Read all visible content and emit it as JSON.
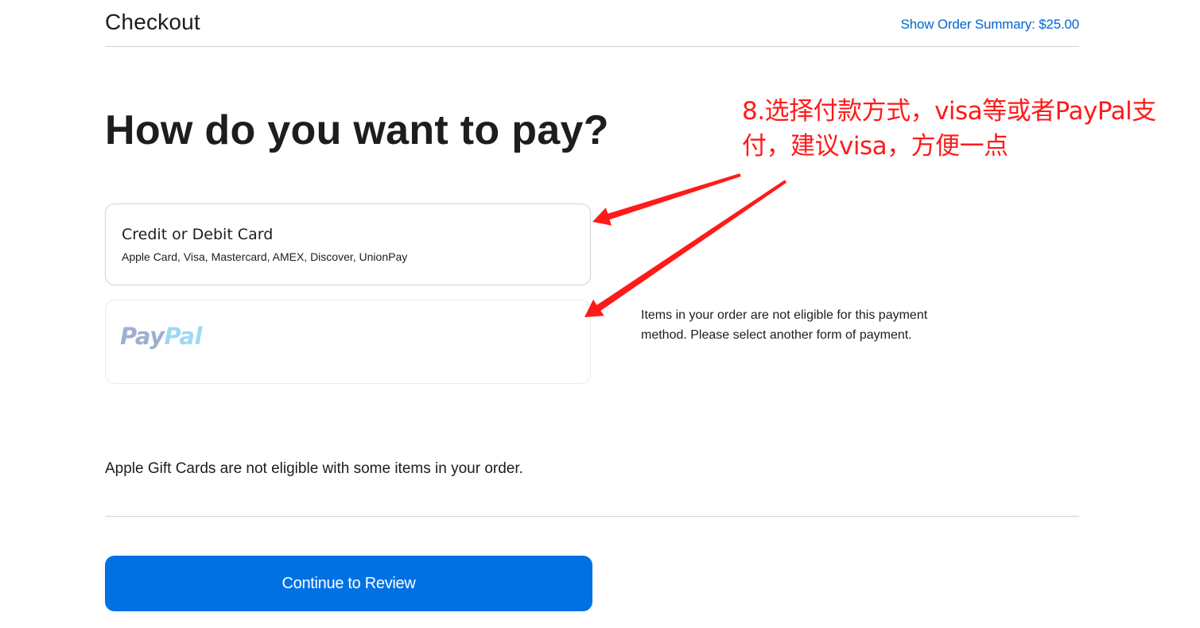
{
  "header": {
    "title": "Checkout",
    "summary_link": "Show Order Summary: $25.00"
  },
  "main": {
    "headline": "How do you want to pay?",
    "options": [
      {
        "title": "Credit or Debit Card",
        "subtitle": "Apple Card, Visa, Mastercard, AMEX, Discover, UnionPay"
      },
      {
        "logo_pay": "Pay",
        "logo_pal": "Pal",
        "disabled": true
      }
    ],
    "paypal_note": "Items in your order are not eligible for this payment method. Please select another form of payment.",
    "giftcard_note": "Apple Gift Cards are not eligible with some items in your order.",
    "continue_label": "Continue to Review"
  },
  "annotation": {
    "text": "8.选择付款方式，visa等或者PayPal支付，建议visa，方便一点",
    "color": "#ff1a1a"
  },
  "colors": {
    "link": "#0066cc",
    "primary_button": "#0071e3",
    "text": "#1d1d1f",
    "border": "#d2d2d7"
  }
}
